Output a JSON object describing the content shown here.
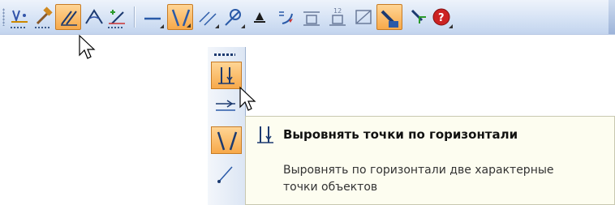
{
  "toolbar": {
    "buttons": [
      {
        "name": "point-on-curve-icon"
      },
      {
        "name": "hammer-icon"
      },
      {
        "name": "parallel-constraint-icon",
        "active": true
      },
      {
        "name": "angle-icon"
      },
      {
        "name": "add-dimension-icon"
      },
      {
        "name": "horizontal-line-icon"
      },
      {
        "name": "symmetry-constraint-icon",
        "active": true
      },
      {
        "name": "parallel-lines-icon"
      },
      {
        "name": "tangent-icon"
      },
      {
        "name": "fix-point-icon"
      },
      {
        "name": "arrow-constraint-icon"
      },
      {
        "name": "dimension-box-icon"
      },
      {
        "name": "dimension-12-icon",
        "label": "12"
      },
      {
        "name": "perpendicular-box-icon"
      },
      {
        "name": "pencil-paper-icon",
        "active": true
      },
      {
        "name": "cursor-tool-icon"
      },
      {
        "name": "help-icon"
      }
    ]
  },
  "dropdown": {
    "items": [
      {
        "name": "align-points-horizontal-icon",
        "active": true
      },
      {
        "name": "align-horizontal-arrows-icon"
      },
      {
        "name": "symmetry-icon"
      },
      {
        "name": "diagonal-line-icon"
      }
    ]
  },
  "tooltip": {
    "title": "Выровнять точки по горизонтали",
    "description": "Выровнять по горизонтали две характерные точки объектов"
  }
}
